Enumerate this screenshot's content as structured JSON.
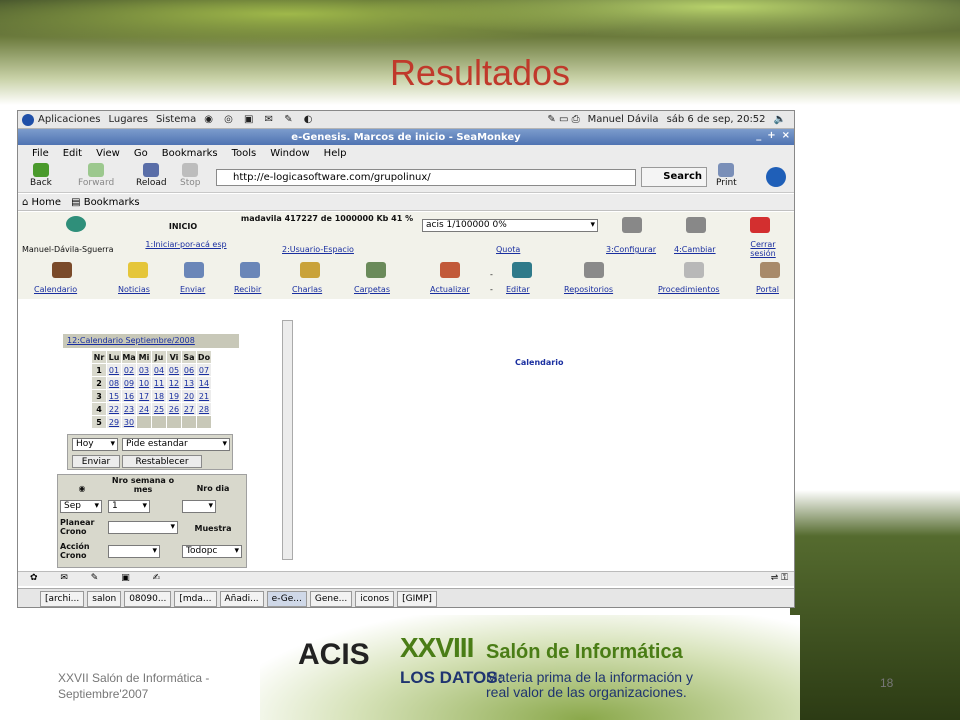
{
  "slide": {
    "title": "Resultados",
    "footer": "XXVII Salón de Informática - Septiembre'2007",
    "page_number": "18"
  },
  "logo": {
    "acis": "ACIS",
    "event_number": "XXVIII",
    "event_name": "Salón de Informática",
    "tagline_head": "LOS DATOS:",
    "tagline_body": "Materia prima de la información y real valor de las organizaciones."
  },
  "panel": {
    "menus": [
      "Aplicaciones",
      "Lugares",
      "Sistema"
    ],
    "user": "Manuel Dávila",
    "datetime": "sáb 6 de sep, 20:52"
  },
  "window": {
    "title": "e-Genesis. Marcos de inicio - SeaMonkey",
    "controls": [
      "_",
      "+",
      "×"
    ]
  },
  "menubar": [
    "File",
    "Edit",
    "View",
    "Go",
    "Bookmarks",
    "Tools",
    "Window",
    "Help"
  ],
  "nav": {
    "back": "Back",
    "forward": "Forward",
    "reload": "Reload",
    "stop": "Stop",
    "url": "http://e-logicasoftware.com/grupolinux/",
    "search": "Search",
    "print": "Print"
  },
  "bookmarks": {
    "home": "Home",
    "bookmarks": "Bookmarks"
  },
  "app": {
    "inicio": "INICIO",
    "quota_text": "madavila 417227 de 1000000 Kb 41 %",
    "acis_select": "acis 1/100000 0%",
    "user_name": "Manuel-Dávila-Sguerra",
    "links_row1": [
      "1:Iniciar-por-acá esp",
      "2:Usuario-Espacio",
      "Quota",
      "3:Configurar",
      "4:Cambiar",
      "Cerrar sesión"
    ],
    "links_row2": [
      "Calendario",
      "Noticias",
      "Enviar",
      "Recibir",
      "Charlas",
      "Carpetas",
      "Actualizar",
      "Editar",
      "Repositorios",
      "Procedimientos",
      "Portal"
    ],
    "separator": "-"
  },
  "calendar": {
    "title": "12:Calendario Septiembre/2008",
    "headers": [
      "Nr",
      "Lu",
      "Ma",
      "Mi",
      "Ju",
      "Vi",
      "Sa",
      "Do"
    ],
    "weeks": [
      [
        "1",
        "01",
        "02",
        "03",
        "04",
        "05",
        "06",
        "07"
      ],
      [
        "2",
        "08",
        "09",
        "10",
        "11",
        "12",
        "13",
        "14"
      ],
      [
        "3",
        "15",
        "16",
        "17",
        "18",
        "19",
        "20",
        "21"
      ],
      [
        "4",
        "22",
        "23",
        "24",
        "25",
        "26",
        "27",
        "28"
      ],
      [
        "5",
        "29",
        "30",
        "",
        "",
        "",
        "",
        ""
      ]
    ],
    "hoy": "Hoy",
    "pide": "Pide estandar",
    "enviar": "Enviar",
    "restablecer": "Restablecer",
    "nro_semana": "Nro semana o mes",
    "nro_dia": "Nro dia",
    "mes": "Sep",
    "semana": "1",
    "planear": "Planear Crono",
    "muestra": "Muestra",
    "accion": "Acción Crono",
    "todopc": "Todopc",
    "center_label": "Calendario"
  },
  "taskbar": [
    "[archi...",
    "salon",
    "08090...",
    "[mda...",
    "Añadi...",
    "e-Ge...",
    "Gene...",
    "iconos",
    "[GIMP]"
  ]
}
